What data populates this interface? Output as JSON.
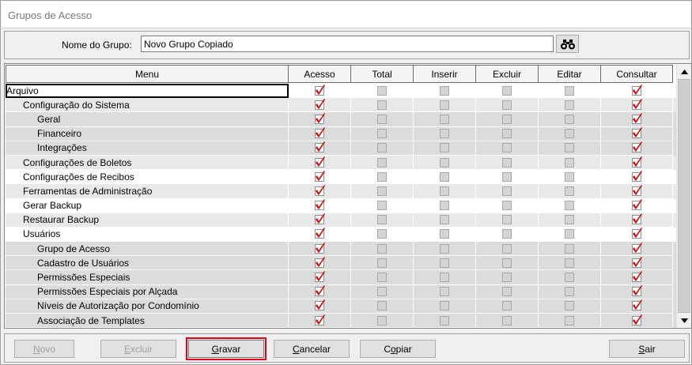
{
  "window": {
    "title": "Grupos de Acesso"
  },
  "group": {
    "label": "Nome do Grupo:",
    "value": "Novo Grupo Copiado",
    "search_icon": "binoculars-icon"
  },
  "grid": {
    "columns": [
      "Menu",
      "Acesso",
      "Total",
      "Inserir",
      "Excluir",
      "Editar",
      "Consultar"
    ],
    "rows": [
      {
        "label": "Arquivo",
        "level": 0,
        "acesso": true,
        "consultar": true
      },
      {
        "label": "Configuração do Sistema",
        "level": 1,
        "acesso": true,
        "consultar": true
      },
      {
        "label": "Geral",
        "level": 2,
        "acesso": true,
        "consultar": true
      },
      {
        "label": "Financeiro",
        "level": 2,
        "acesso": true,
        "consultar": true
      },
      {
        "label": "Integrações",
        "level": 2,
        "acesso": true,
        "consultar": true
      },
      {
        "label": "Configurações de Boletos",
        "level": 1,
        "acesso": true,
        "consultar": true
      },
      {
        "label": "Configurações de Recibos",
        "level": 1,
        "acesso": true,
        "consultar": true
      },
      {
        "label": "Ferramentas de Administração",
        "level": 1,
        "acesso": true,
        "consultar": true
      },
      {
        "label": "Gerar Backup",
        "level": 1,
        "acesso": true,
        "consultar": true
      },
      {
        "label": "Restaurar Backup",
        "level": 1,
        "acesso": true,
        "consultar": true
      },
      {
        "label": "Usuários",
        "level": 1,
        "acesso": true,
        "consultar": true
      },
      {
        "label": "Grupo de Acesso",
        "level": 2,
        "acesso": true,
        "consultar": true
      },
      {
        "label": "Cadastro de Usuários",
        "level": 2,
        "acesso": true,
        "consultar": true
      },
      {
        "label": "Permissões Especiais",
        "level": 2,
        "acesso": true,
        "consultar": true
      },
      {
        "label": "Permissões Especiais por Alçada",
        "level": 2,
        "acesso": true,
        "consultar": true
      },
      {
        "label": "Níveis de Autorização por Condomínio",
        "level": 2,
        "acesso": true,
        "consultar": true
      },
      {
        "label": "Associação de Templates",
        "level": 2,
        "acesso": true,
        "consultar": true
      }
    ]
  },
  "buttons": {
    "novo": {
      "first": "N",
      "rest": "ovo"
    },
    "excluir": {
      "first": "E",
      "rest": "xcluir"
    },
    "gravar": {
      "first": "G",
      "rest": "ravar"
    },
    "cancelar": {
      "first": "C",
      "rest": "ancelar"
    },
    "copiar": {
      "pre": "C",
      "first": "o",
      "rest": "piar"
    },
    "sair": {
      "first": "S",
      "rest": "air"
    }
  },
  "colors": {
    "check_red": "#d40000",
    "highlight_border": "#e3001b"
  }
}
